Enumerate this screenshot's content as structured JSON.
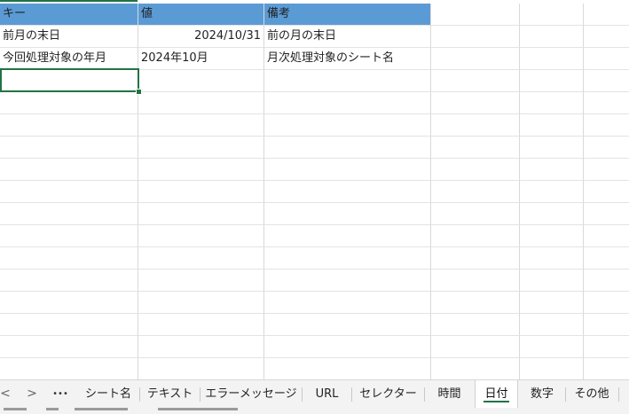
{
  "sheet": {
    "headers": [
      "キー",
      "値",
      "備考"
    ],
    "rows": [
      [
        "前月の末日",
        "2024/10/31",
        "前の月の末日"
      ],
      [
        "今回処理対象の年月",
        "2024年10月",
        "月次処理対象のシート名"
      ]
    ]
  },
  "tabs": {
    "prev_icon": "<",
    "next_icon": ">",
    "more_icon": "•••",
    "items": [
      "シート名",
      "テキスト",
      "エラーメッセージ",
      "URL",
      "セレクター",
      "時間",
      "日付",
      "数字",
      "その他"
    ],
    "active": "日付"
  },
  "colors": {
    "header_fill": "#5b9bd5",
    "accent": "#217346",
    "gridline": "#d9d9d9"
  }
}
